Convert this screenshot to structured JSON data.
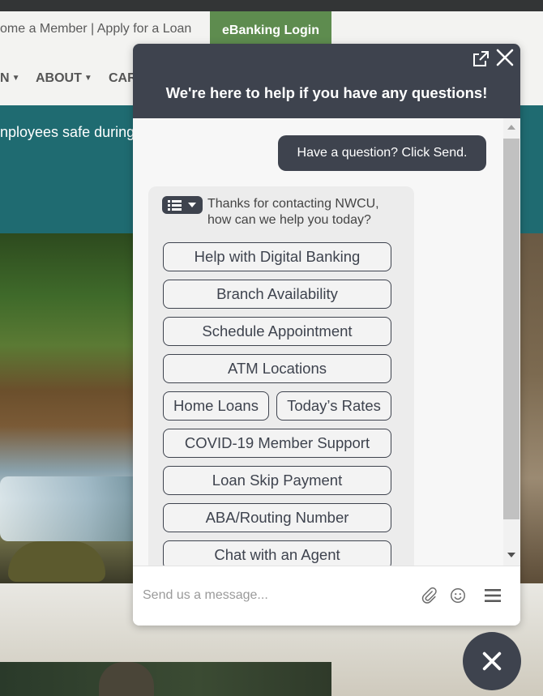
{
  "site": {
    "utility_links": "ome a Member | Apply for a Loan",
    "ebanking_label": "eBanking Login",
    "nav": [
      "N",
      "ABOUT",
      "CAR"
    ],
    "banner_text": "nployees safe during"
  },
  "chat": {
    "header_title": "We're here to help if you have any questions!",
    "user_message": "Have a question? Click Send.",
    "bot_message": "Thanks for contacting NWCU, how can we help you today?",
    "quick_replies": [
      "Help with Digital Banking",
      "Branch Availability",
      "Schedule Appointment",
      "ATM Locations",
      "Home Loans",
      "Today’s Rates",
      "COVID-19 Member Support",
      "Loan Skip Payment",
      "ABA/Routing Number",
      "Chat with an Agent"
    ],
    "input_placeholder": "Send us a message...",
    "icons": [
      "popout-icon",
      "close-icon",
      "list-menu-icon",
      "paperclip-icon",
      "smiley-icon",
      "hamburger-icon"
    ]
  },
  "colors": {
    "chat_dark": "#3e434e",
    "ebanking_green": "#5e8c4f",
    "banner_teal": "#1f6b71"
  }
}
